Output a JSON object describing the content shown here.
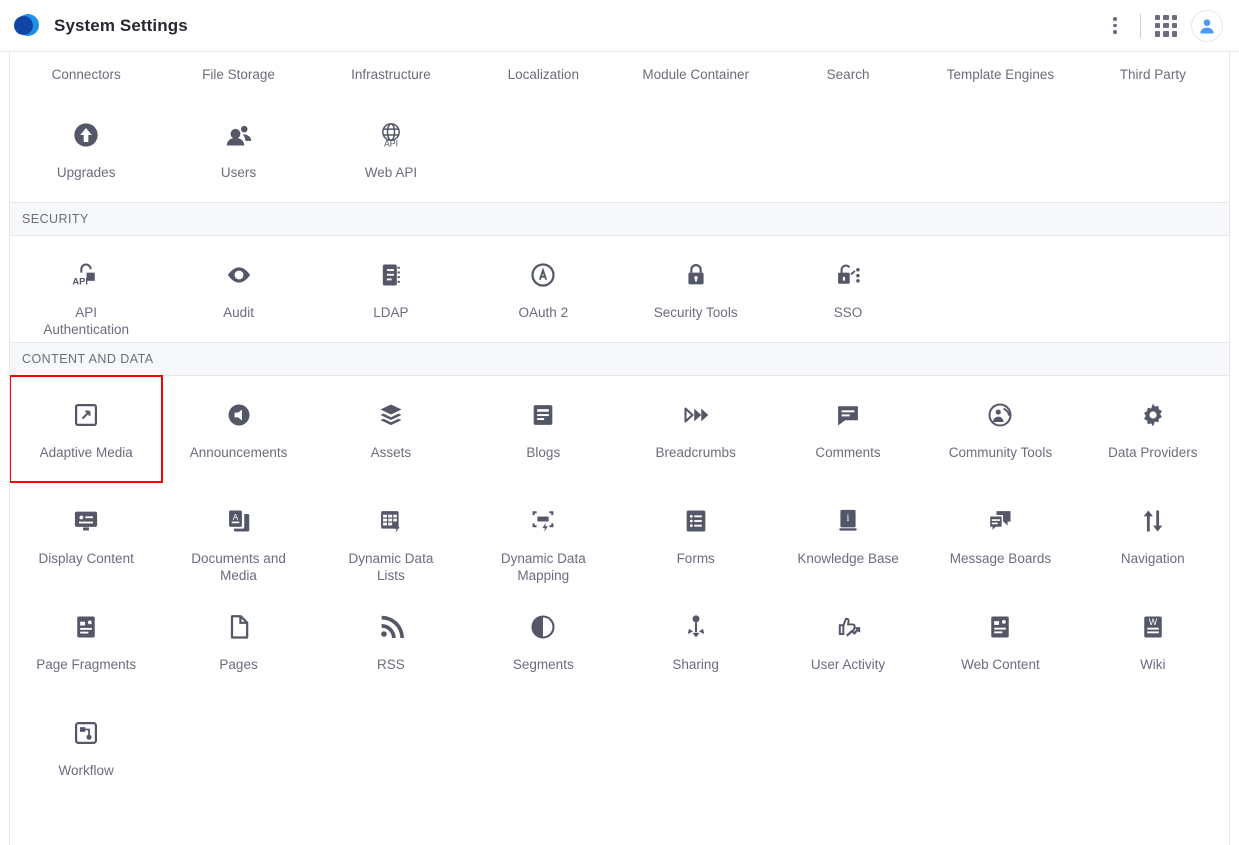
{
  "header": {
    "title": "System Settings",
    "logo_icon": "liferay-logo-icon",
    "kebab_icon": "vertical-dots-icon",
    "grid_icon": "app-grid-icon",
    "avatar_icon": "user-avatar-icon",
    "accent_color": "#1f90e8",
    "logo_dark_color": "#1144a3"
  },
  "colors": {
    "text": "#6b6c7e",
    "title": "#272833",
    "icon": "#535768",
    "section_bg": "#f7f8f9",
    "border": "#e7e7ed",
    "highlight": "#ff0000"
  },
  "sections": [
    {
      "id": "platform-continued",
      "label": "",
      "clipped": true,
      "rows": [
        [
          {
            "label": "Connectors",
            "icon": "connectors-icon",
            "label_only": true
          },
          {
            "label": "File Storage",
            "icon": "file-storage-icon",
            "label_only": true
          },
          {
            "label": "Infrastructure",
            "icon": "infrastructure-icon",
            "label_only": true
          },
          {
            "label": "Localization",
            "icon": "localization-icon",
            "label_only": true
          },
          {
            "label": "Module Container",
            "icon": "module-container-icon",
            "label_only": true
          },
          {
            "label": "Search",
            "icon": "search-icon",
            "label_only": true
          },
          {
            "label": "Template Engines",
            "icon": "template-engines-icon",
            "label_only": true
          },
          {
            "label": "Third Party",
            "icon": "third-party-icon",
            "label_only": true
          }
        ],
        [
          {
            "label": "Upgrades",
            "icon": "upgrade-arrow-icon"
          },
          {
            "label": "Users",
            "icon": "users-icon"
          },
          {
            "label": "Web API",
            "icon": "web-api-globe-icon"
          }
        ]
      ]
    },
    {
      "id": "security",
      "label": "SECURITY",
      "clipped": false,
      "rows": [
        [
          {
            "label": "API Authentication",
            "icon": "api-unlock-icon"
          },
          {
            "label": "Audit",
            "icon": "eye-icon"
          },
          {
            "label": "LDAP",
            "icon": "ldap-book-icon"
          },
          {
            "label": "OAuth 2",
            "icon": "oauth-circle-a-icon"
          },
          {
            "label": "Security Tools",
            "icon": "padlock-icon"
          },
          {
            "label": "SSO",
            "icon": "sso-unlock-dots-icon"
          }
        ]
      ]
    },
    {
      "id": "content-and-data",
      "label": "CONTENT AND DATA",
      "clipped": false,
      "rows": [
        [
          {
            "label": "Adaptive Media",
            "icon": "adaptive-media-resize-icon",
            "highlighted": true
          },
          {
            "label": "Announcements",
            "icon": "megaphone-icon"
          },
          {
            "label": "Assets",
            "icon": "layers-icon"
          },
          {
            "label": "Blogs",
            "icon": "blog-document-icon"
          },
          {
            "label": "Breadcrumbs",
            "icon": "breadcrumbs-chevrons-icon"
          },
          {
            "label": "Comments",
            "icon": "comment-bubble-icon"
          },
          {
            "label": "Community Tools",
            "icon": "community-person-icon"
          },
          {
            "label": "Data Providers",
            "icon": "gear-icon"
          }
        ],
        [
          {
            "label": "Display Content",
            "icon": "display-monitor-icon"
          },
          {
            "label": "Documents and Media",
            "icon": "documents-media-icon"
          },
          {
            "label": "Dynamic Data Lists",
            "icon": "dynamic-data-list-icon"
          },
          {
            "label": "Dynamic Data Mapping",
            "icon": "dynamic-data-mapping-icon"
          },
          {
            "label": "Forms",
            "icon": "forms-list-icon"
          },
          {
            "label": "Knowledge Base",
            "icon": "knowledge-book-icon"
          },
          {
            "label": "Message Boards",
            "icon": "message-boards-icon"
          },
          {
            "label": "Navigation",
            "icon": "navigation-arrows-icon"
          }
        ],
        [
          {
            "label": "Page Fragments",
            "icon": "page-fragment-icon"
          },
          {
            "label": "Pages",
            "icon": "page-document-icon"
          },
          {
            "label": "RSS",
            "icon": "rss-feed-icon"
          },
          {
            "label": "Segments",
            "icon": "segments-half-circle-icon"
          },
          {
            "label": "Sharing",
            "icon": "sharing-node-icon"
          },
          {
            "label": "User Activity",
            "icon": "user-activity-thumb-icon"
          },
          {
            "label": "Web Content",
            "icon": "web-content-icon"
          },
          {
            "label": "Wiki",
            "icon": "wiki-document-icon"
          }
        ],
        [
          {
            "label": "Workflow",
            "icon": "workflow-icon"
          }
        ]
      ]
    }
  ]
}
